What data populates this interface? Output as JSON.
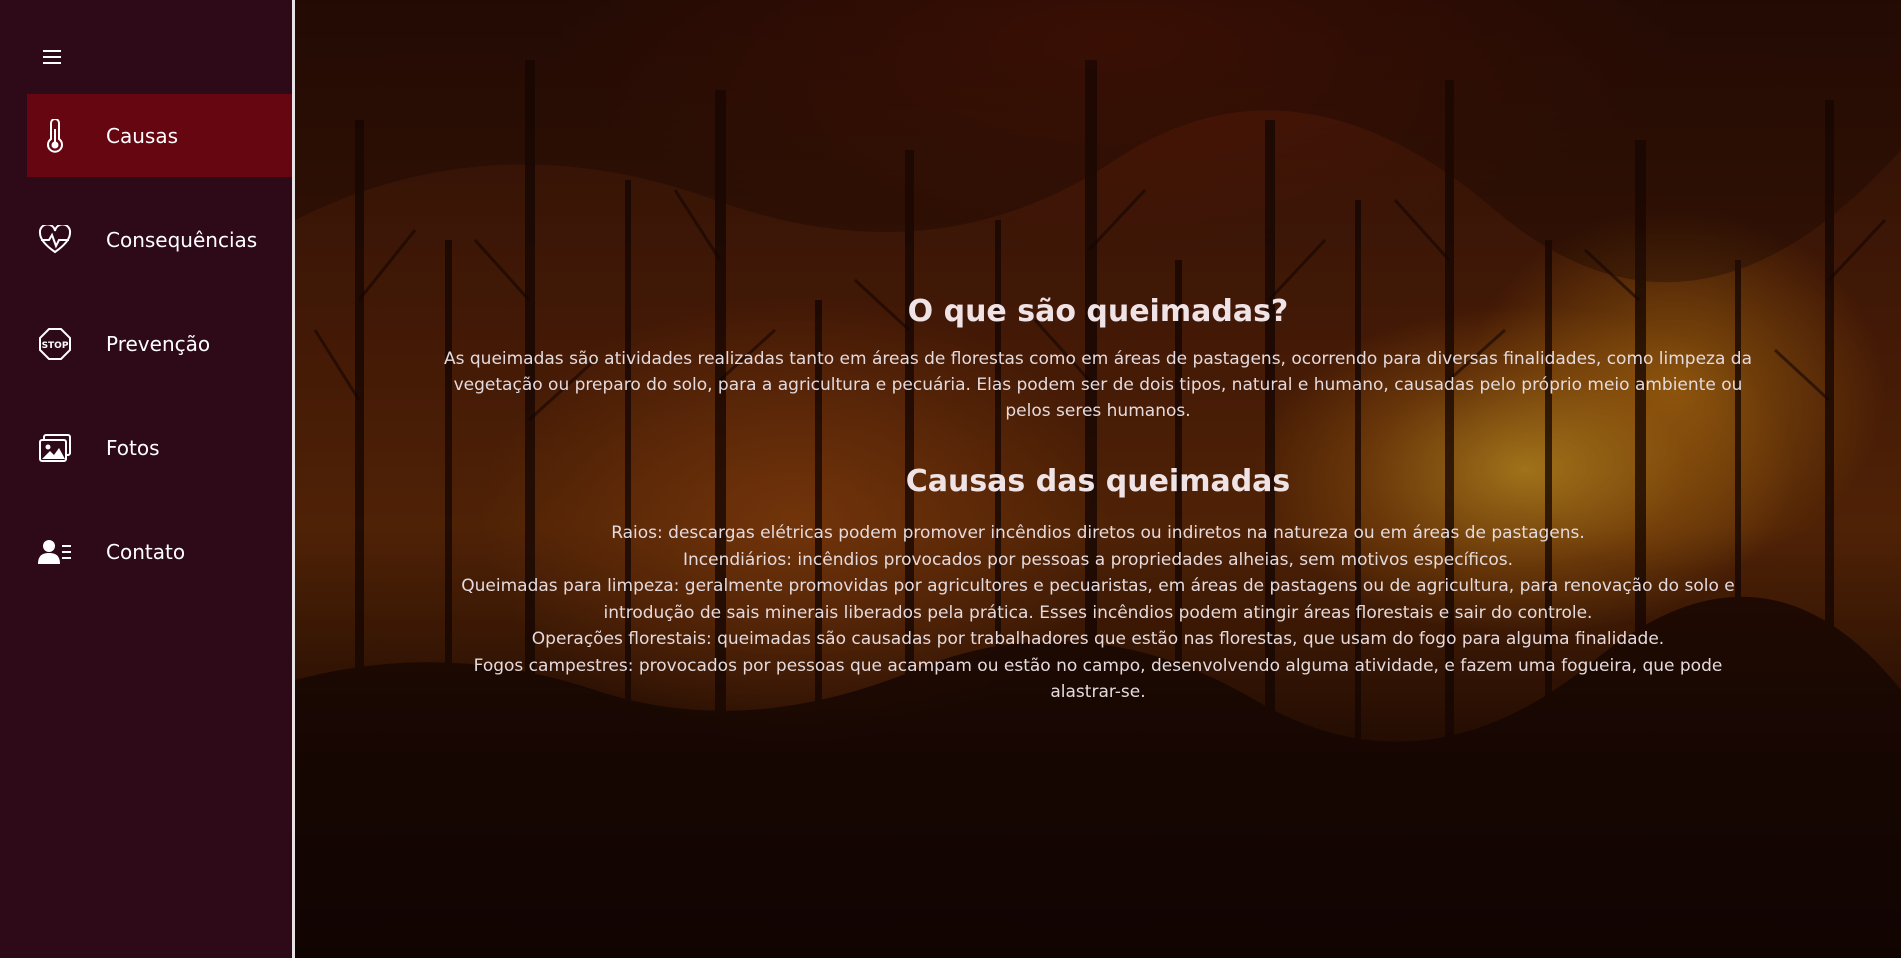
{
  "sidebar": {
    "menu_icon": "hamburger-icon",
    "items": [
      {
        "label": "Causas",
        "icon": "thermometer-icon",
        "active": true
      },
      {
        "label": "Consequências",
        "icon": "heart-pulse-icon",
        "active": false
      },
      {
        "label": "Prevenção",
        "icon": "stop-sign-icon",
        "active": false
      },
      {
        "label": "Fotos",
        "icon": "photos-icon",
        "active": false
      },
      {
        "label": "Contato",
        "icon": "contact-icon",
        "active": false
      }
    ],
    "stop_text": "STOP"
  },
  "main": {
    "intro_title": "O que são queimadas?",
    "intro_text": "As queimadas são atividades realizadas tanto em áreas de florestas como em áreas de pastagens, ocorrendo para diversas finalidades, como limpeza da vegetação ou preparo do solo, para a agricultura e pecuária. Elas podem ser de dois tipos, natural e humano, causadas pelo próprio meio ambiente ou pelos seres humanos.",
    "causes_title": "Causas das queimadas",
    "causes": [
      "Raios: descargas elétricas podem promover incêndios diretos ou indiretos na natureza ou em áreas de pastagens.",
      "Incendiários: incêndios provocados por pessoas a propriedades alheias, sem motivos específicos.",
      "Queimadas para limpeza: geralmente promovidas por agricultores e pecuaristas, em áreas de pastagens ou de agricultura, para renovação do solo e introdução de sais minerais liberados pela prática. Esses incêndios podem atingir áreas florestais e sair do controle.",
      "Operações florestais: queimadas são causadas por trabalhadores que estão nas florestas, que usam do fogo para alguma finalidade.",
      "Fogos campestres: provocados por pessoas que acampam ou estão no campo, desenvolvendo alguma atividade, e fazem uma fogueira, que pode alastrar-se."
    ]
  },
  "colors": {
    "sidebar_bg": "#2e0a18",
    "active_item_bg": "#650611",
    "text": "#e9dfe3"
  }
}
